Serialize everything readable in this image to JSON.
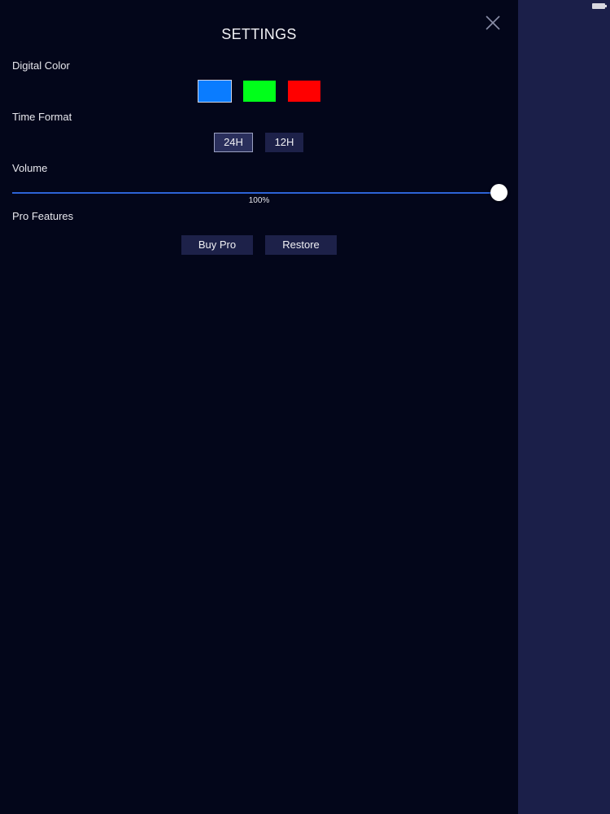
{
  "header": {
    "title": "SETTINGS",
    "close_icon": "close-icon"
  },
  "digital_color": {
    "label": "Digital Color",
    "options": [
      {
        "name": "blue",
        "color": "#0a7cff",
        "selected": true
      },
      {
        "name": "green",
        "color": "#00ff1a",
        "selected": false
      },
      {
        "name": "red",
        "color": "#ff0000",
        "selected": false
      }
    ]
  },
  "time_format": {
    "label": "Time Format",
    "options": [
      "24H",
      "12H"
    ],
    "selected": "24H"
  },
  "volume": {
    "label": "Volume",
    "value_text": "100%",
    "level": 1.0
  },
  "pro_features": {
    "label": "Pro Features",
    "buy_label": "Buy Pro",
    "restore_label": "Restore"
  },
  "colors": {
    "background": "#03061a",
    "side_panel": "#1b1f49",
    "button_bg": "#1d2149",
    "slider_track": "#2b3a86",
    "slider_fill": "#2d63d6"
  }
}
